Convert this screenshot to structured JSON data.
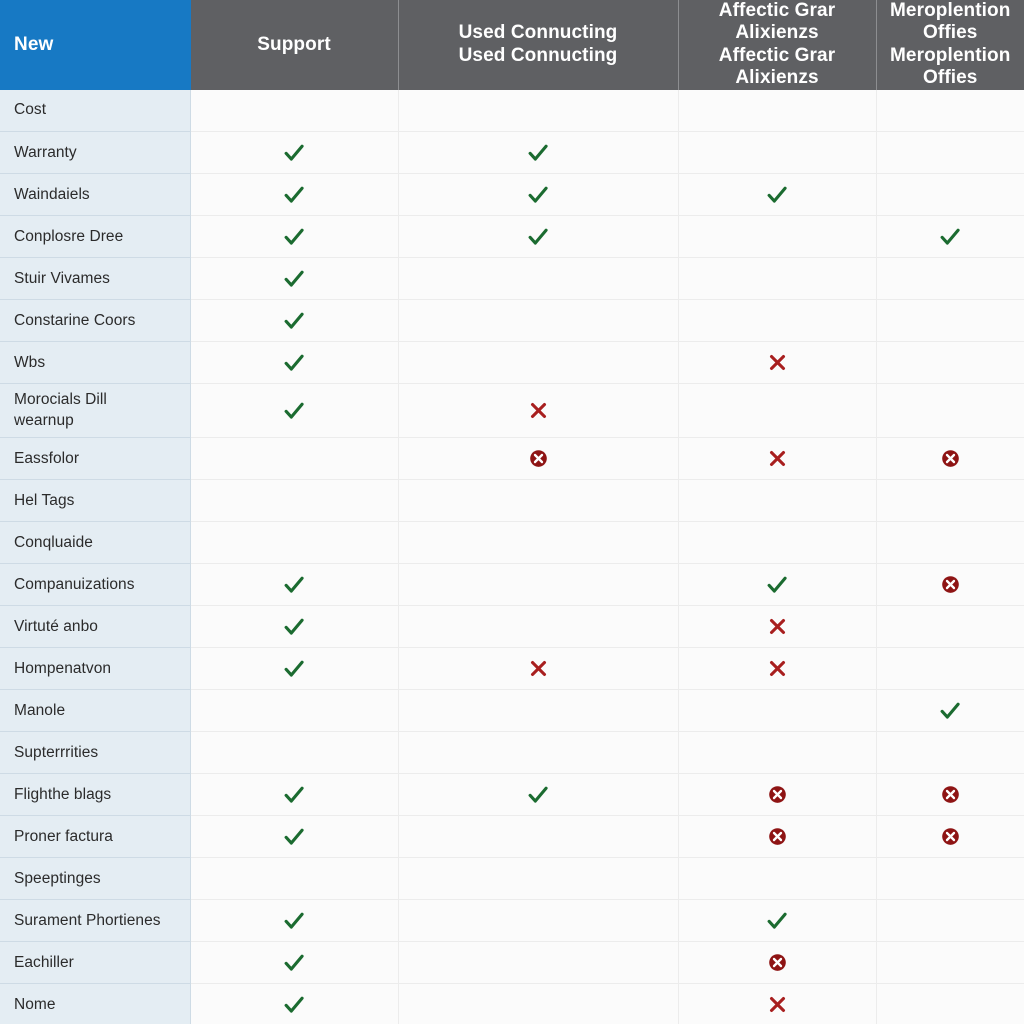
{
  "table": {
    "headers": [
      {
        "label": "New",
        "accent": "#1779c4",
        "type": "label-header"
      },
      {
        "label": "Support",
        "accent": "#5f6063",
        "type": "column-header"
      },
      {
        "label": "Used\nConnucting",
        "accent": "#5f6063",
        "type": "column-header"
      },
      {
        "label": "Affectic Grar\nAlixienzs",
        "accent": "#5f6063",
        "type": "column-header"
      },
      {
        "label": "Meroplention\nOffies",
        "accent": "#5f6063",
        "type": "column-header"
      }
    ],
    "icons": {
      "check": "check-icon",
      "cross": "cross-icon",
      "circle_cross": "circle-cross-icon",
      "empty": "empty-cell"
    },
    "colors": {
      "header_accent": "#1779c4",
      "header_gray": "#5f6063",
      "label_background": "#e4edf3",
      "cell_background": "#fbfbfb",
      "check_green": "#1b6b30",
      "cross_red": "#a81f1f",
      "circle_red": "#8e1414"
    },
    "rows": [
      {
        "label": "Cost",
        "two_line": false,
        "values": [
          "empty",
          "empty",
          "empty",
          "empty"
        ]
      },
      {
        "label": "Warranty",
        "two_line": false,
        "values": [
          "check",
          "check",
          "empty",
          "empty"
        ]
      },
      {
        "label": "Waindaiels",
        "two_line": false,
        "values": [
          "check",
          "check",
          "check",
          "empty"
        ]
      },
      {
        "label": "Conplosre Dree",
        "two_line": false,
        "values": [
          "check",
          "check",
          "empty",
          "check"
        ]
      },
      {
        "label": "Stuir Vivames",
        "two_line": false,
        "values": [
          "check",
          "empty",
          "empty",
          "empty"
        ]
      },
      {
        "label": "Constarine Coors",
        "two_line": false,
        "values": [
          "check",
          "empty",
          "empty",
          "empty"
        ]
      },
      {
        "label": "Wbs",
        "two_line": false,
        "values": [
          "check",
          "empty",
          "cross",
          "empty"
        ]
      },
      {
        "label": "Morocials Dill\nwearnup",
        "two_line": true,
        "values": [
          "check",
          "cross",
          "empty",
          "empty"
        ]
      },
      {
        "label": "Eassfolor",
        "two_line": false,
        "values": [
          "empty",
          "circle_cross",
          "cross",
          "circle_cross"
        ]
      },
      {
        "label": "Hel Tags",
        "two_line": false,
        "values": [
          "empty",
          "empty",
          "empty",
          "empty"
        ]
      },
      {
        "label": "Conqluaide",
        "two_line": false,
        "values": [
          "empty",
          "empty",
          "empty",
          "empty"
        ]
      },
      {
        "label": "Companuizations",
        "two_line": false,
        "values": [
          "check",
          "empty",
          "check",
          "circle_cross"
        ]
      },
      {
        "label": "Virtuté anbo",
        "two_line": false,
        "values": [
          "check",
          "empty",
          "cross",
          "empty"
        ]
      },
      {
        "label": "Hompenatvon",
        "two_line": false,
        "values": [
          "check",
          "cross",
          "cross",
          "empty"
        ]
      },
      {
        "label": "Manole",
        "two_line": false,
        "values": [
          "empty",
          "empty",
          "empty",
          "check"
        ]
      },
      {
        "label": "Supterrrities",
        "two_line": false,
        "values": [
          "empty",
          "empty",
          "empty",
          "empty"
        ]
      },
      {
        "label": "Flighthe blags",
        "two_line": false,
        "values": [
          "check",
          "check",
          "circle_cross",
          "circle_cross"
        ]
      },
      {
        "label": "Proner factura",
        "two_line": false,
        "values": [
          "check",
          "empty",
          "circle_cross",
          "circle_cross"
        ]
      },
      {
        "label": "Speeptinges",
        "two_line": false,
        "values": [
          "empty",
          "empty",
          "empty",
          "empty"
        ]
      },
      {
        "label": "Surament Phortienes",
        "two_line": false,
        "values": [
          "check",
          "empty",
          "check",
          "empty"
        ]
      },
      {
        "label": "Eachiller",
        "two_line": false,
        "values": [
          "check",
          "empty",
          "circle_cross",
          "empty"
        ]
      },
      {
        "label": "Nome",
        "two_line": false,
        "values": [
          "check",
          "empty",
          "cross",
          "empty"
        ]
      }
    ]
  }
}
